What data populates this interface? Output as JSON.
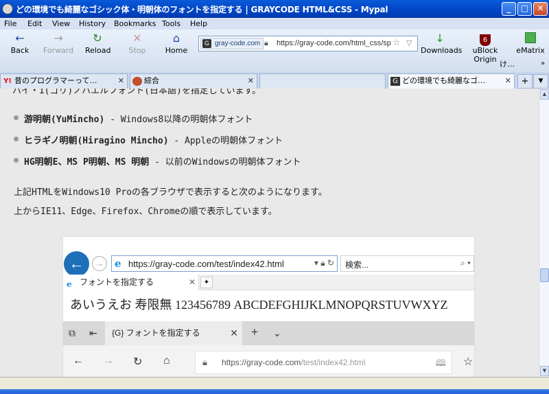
{
  "window": {
    "title": "どの環境でも綺麗なゴシック体・明朝体のフォントを指定する | GRAYCODE HTML&CSS - Mypal",
    "controls": {
      "minimize": "_",
      "maximize": "□",
      "close": "✕"
    }
  },
  "menu": [
    "File",
    "Edit",
    "View",
    "History",
    "Bookmarks",
    "Tools",
    "Help"
  ],
  "toolbar": {
    "back": "Back",
    "forward": "Forward",
    "reload": "Reload",
    "stop": "Stop",
    "home": "Home",
    "downloads": "Downloads",
    "ublock": "uBlock Origin",
    "ematrix": "eMatrix",
    "overflow": "け…",
    "ublock_badge": "6"
  },
  "urlbar": {
    "site": "gray-code.com",
    "url": "https://gray-code.com/html_css/sp"
  },
  "tabs": [
    {
      "label": "昔のプログラマーって…",
      "icon": "yahoo-icon"
    },
    {
      "label": "綜合",
      "icon": "avatar-icon"
    },
    {
      "label": "",
      "icon": ""
    },
    {
      "label": "どの環境でも綺麗なゴ…",
      "icon": "graycode-icon",
      "active": true
    }
  ],
  "article": {
    "cut_line": "ハイ・1(ゴリ)ノバエルフォント(日本語)を指定しています。",
    "bullets": [
      {
        "name": "游明朝(YuMincho)",
        "desc": " - Windows8以降の明朝体フォント"
      },
      {
        "name": "ヒラギノ明朝(Hiragino Mincho)",
        "desc": " - Appleの明朝体フォント"
      },
      {
        "name": "HG明朝E、MS P明朝、MS 明朝",
        "desc": " - 以前のWindowsの明朝体フォント"
      }
    ],
    "para1": "上記HTMLをWindows10 Proの各ブラウザで表示すると次のようになります。",
    "para2": "上からIE11、Edge、Firefox、Chromeの順で表示しています。"
  },
  "screenshot": {
    "ie_url": "https://gray-code.com/test/index42.html",
    "ie_search": "検索...",
    "ie_tab": "フォントを指定する",
    "sample": "あいうえお 寿限無 123456789 ABCDEFGHIJKLMNOPQRSTUVWXYZ",
    "edge_tab": "{G} フォントを指定する",
    "edge_url_prefix": "https://gray-code.com",
    "edge_url_path": "/test/index42.html"
  }
}
